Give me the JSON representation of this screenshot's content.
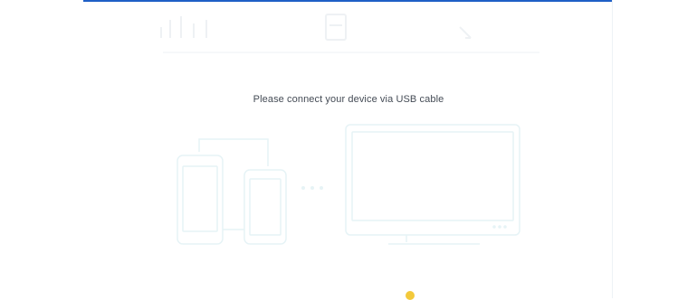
{
  "main": {
    "prompt": "Please connect your device via USB cable"
  },
  "footer": {
    "icon": "info-icon",
    "hint_color": "#c2d8f3"
  },
  "colors": {
    "accent": "#1f5fc6",
    "illustration_line": "#e6f3f6",
    "text": "#444b55"
  }
}
